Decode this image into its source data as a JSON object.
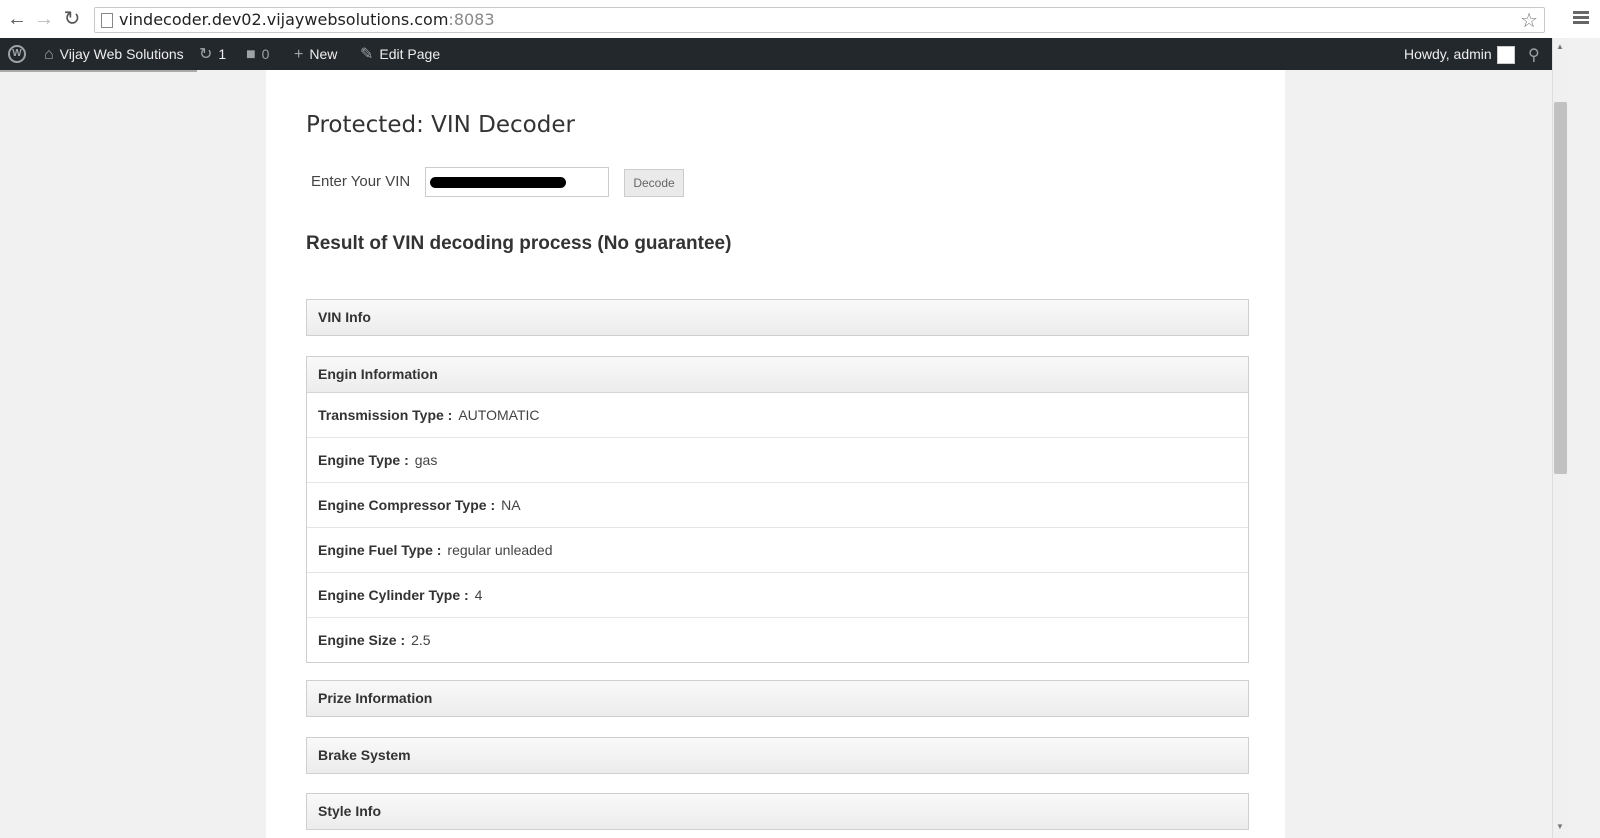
{
  "browser": {
    "url_host": "vindecoder.dev02.vijaywebsolutions.com",
    "url_port": ":8083"
  },
  "admin_bar": {
    "site_name": "Vijay Web Solutions",
    "updates_count": "1",
    "comments_count": "0",
    "new_label": "New",
    "edit_label": "Edit Page",
    "greeting": "Howdy, admin"
  },
  "page": {
    "title": "Protected: VIN Decoder",
    "vin_label": "Enter Your VIN",
    "decode_button": "Decode",
    "result_heading": "Result of VIN decoding process (No guarantee)"
  },
  "panels": {
    "vin_info": "VIN Info",
    "engine": {
      "title": "Engin Information",
      "rows": [
        {
          "label": "Transmission Type :",
          "value": "AUTOMATIC"
        },
        {
          "label": "Engine Type :",
          "value": "gas"
        },
        {
          "label": "Engine Compressor Type :",
          "value": "NA"
        },
        {
          "label": "Engine Fuel Type :",
          "value": "regular unleaded"
        },
        {
          "label": "Engine Cylinder Type :",
          "value": "4"
        },
        {
          "label": "Engine Size :",
          "value": "2.5"
        }
      ]
    },
    "prize": "Prize Information",
    "brake": "Brake System",
    "style": "Style Info"
  }
}
